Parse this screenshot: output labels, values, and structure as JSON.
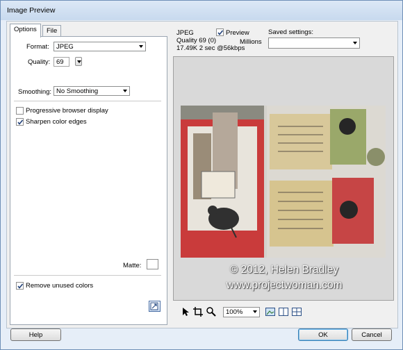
{
  "window": {
    "title": "Image Preview"
  },
  "tabs": [
    {
      "label": "Options"
    },
    {
      "label": "File"
    }
  ],
  "options": {
    "format_label": "Format:",
    "format_value": "JPEG",
    "quality_label": "Quality:",
    "quality_value": "69",
    "smoothing_label": "Smoothing:",
    "smoothing_value": "No Smoothing",
    "progressive_label": "Progressive browser display",
    "progressive_checked": false,
    "sharpen_label": "Sharpen color edges",
    "sharpen_checked": true,
    "matte_label": "Matte:",
    "remove_label": "Remove unused colors",
    "remove_checked": true
  },
  "preview_info": {
    "format": "JPEG",
    "quality": "Quality 69 (0)",
    "size": "17.49K  2 sec @56kbps",
    "preview_label": "Preview",
    "preview_checked": true,
    "colors": "Millions",
    "saved_settings_label": "Saved settings:",
    "saved_settings_value": ""
  },
  "watermark": {
    "line1": "© 2012, Helen Bradley",
    "line2": "www.projectwoman.com"
  },
  "toolbar": {
    "zoom_value": "100%",
    "icons": [
      "pointer-icon",
      "crop-icon",
      "zoom-icon",
      "single-view-icon",
      "two-up-view-icon",
      "four-up-view-icon"
    ]
  },
  "buttons": {
    "help": "Help",
    "ok": "OK",
    "cancel": "Cancel"
  }
}
